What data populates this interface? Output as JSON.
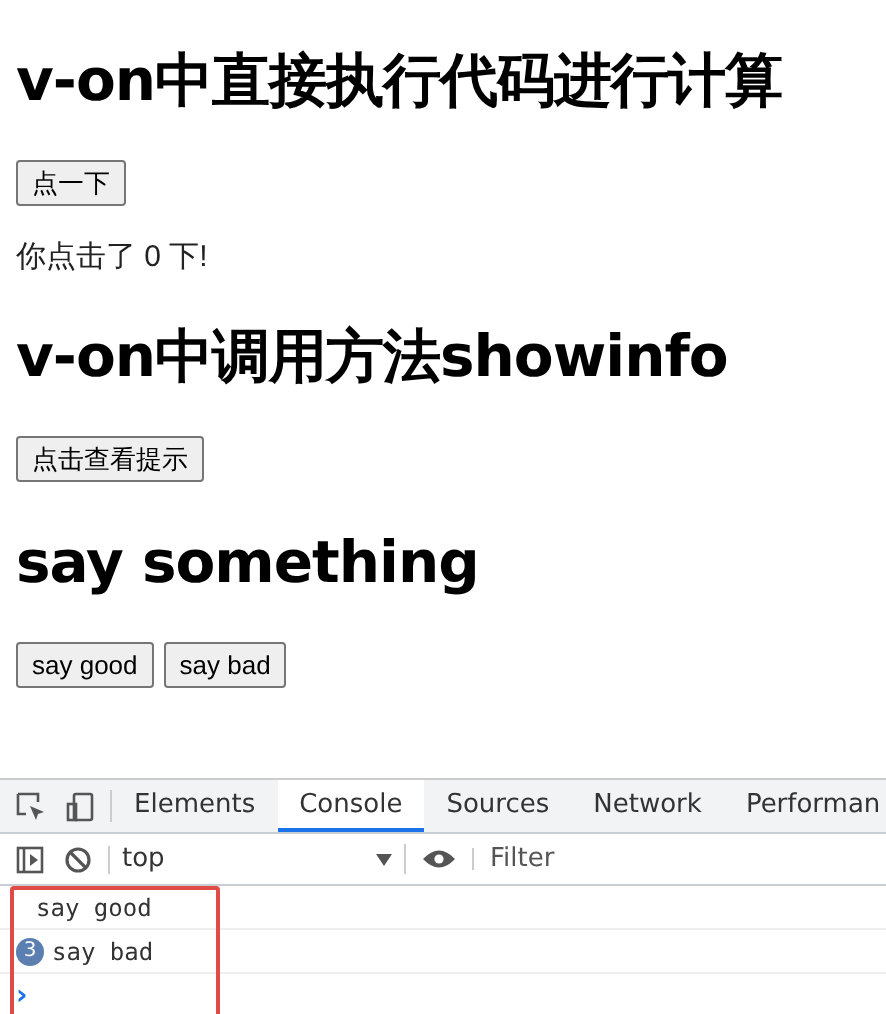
{
  "sections": [
    {
      "heading": "v-on中直接执行代码进行计算",
      "buttons": [
        "点一下"
      ],
      "text": "你点击了 0 下!"
    },
    {
      "heading": "v-on中调用方法showinfo",
      "buttons": [
        "点击查看提示"
      ]
    },
    {
      "heading": "say something",
      "buttons": [
        "say good",
        "say bad"
      ]
    }
  ],
  "devtools": {
    "tabs": [
      {
        "label": "Elements",
        "selected": false
      },
      {
        "label": "Console",
        "selected": true
      },
      {
        "label": "Sources",
        "selected": false
      },
      {
        "label": "Network",
        "selected": false
      },
      {
        "label": "Performan",
        "selected": false
      }
    ],
    "context": "top",
    "filter": {
      "placeholder": "Filter"
    },
    "messages": [
      {
        "text": "say good"
      },
      {
        "text": "say bad",
        "count": "3"
      }
    ],
    "prompt": "›",
    "highlighted": true
  }
}
